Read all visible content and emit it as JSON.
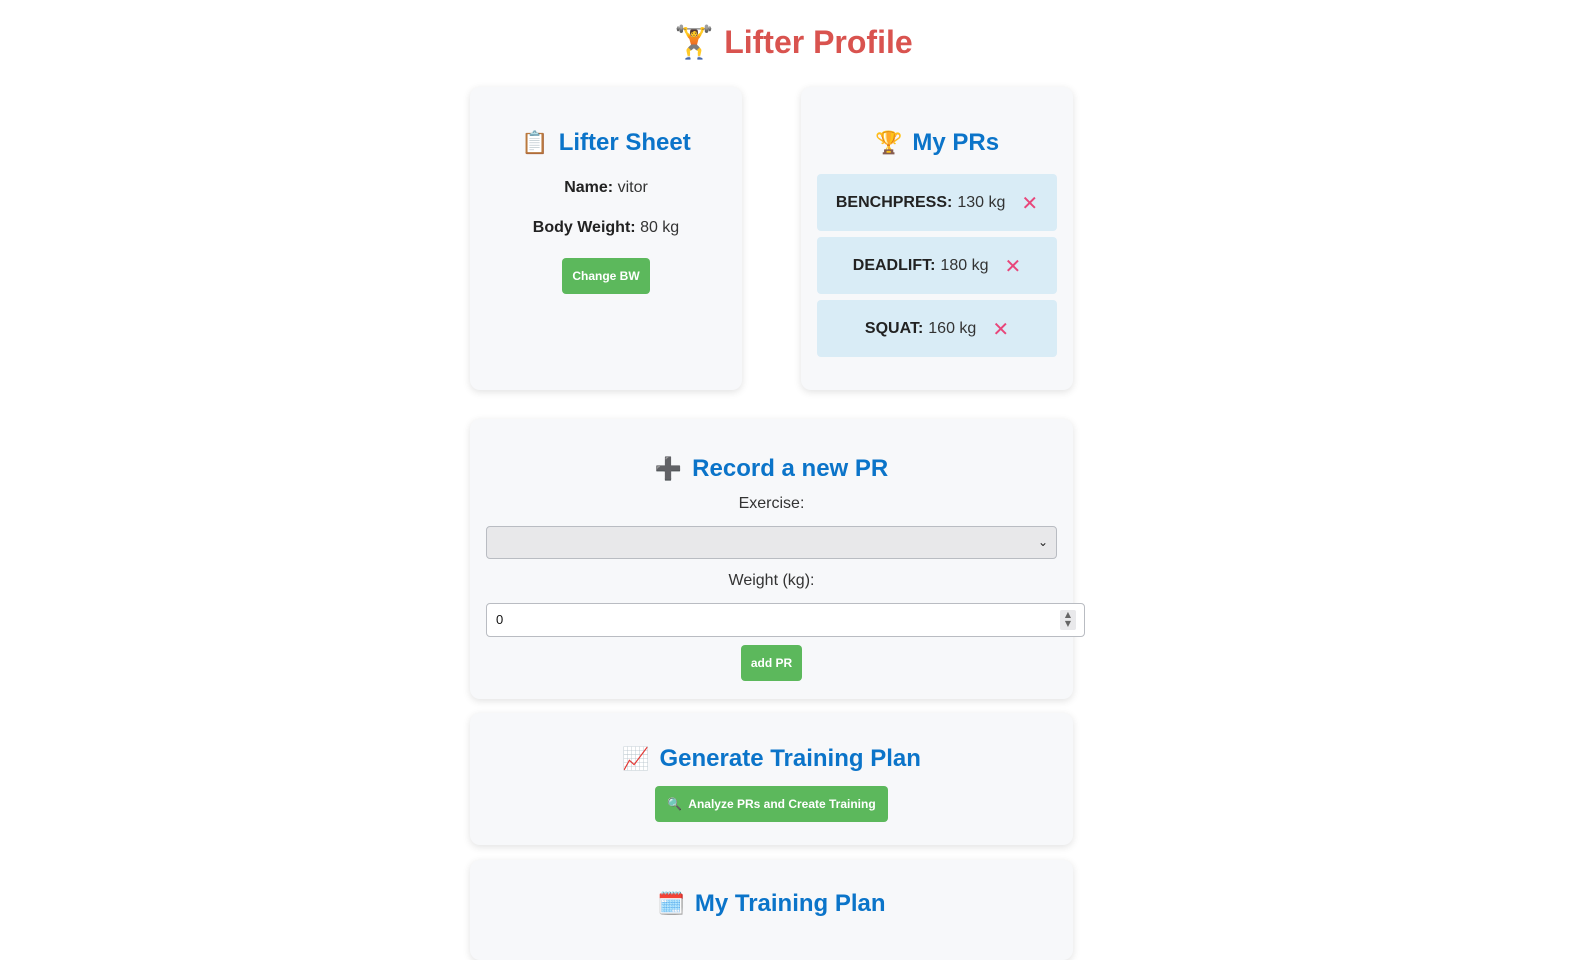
{
  "page": {
    "title": "Lifter Profile",
    "title_icon": "weightlifter-icon",
    "title_emoji": "🏋️"
  },
  "lifter_sheet": {
    "heading": "Lifter Sheet",
    "heading_icon": "clipboard-icon",
    "heading_emoji": "📋",
    "name_label": "Name:",
    "name_value": "vitor",
    "bw_label": "Body Weight:",
    "bw_value": "80 kg",
    "change_bw_label": "Change BW"
  },
  "my_prs": {
    "heading": "My PRs",
    "heading_icon": "trophy-icon",
    "heading_emoji": "🏆",
    "items": [
      {
        "exercise": "BENCHPRESS:",
        "weight": "130 kg"
      },
      {
        "exercise": "DEADLIFT:",
        "weight": "180 kg"
      },
      {
        "exercise": "SQUAT:",
        "weight": "160 kg"
      }
    ],
    "delete_glyph": "✕"
  },
  "record_pr": {
    "heading": "Record a new PR",
    "heading_icon": "plus-icon",
    "heading_emoji": "➕",
    "exercise_label": "Exercise:",
    "exercise_selected": "",
    "weight_label": "Weight (kg):",
    "weight_value": "0",
    "add_label": "add PR"
  },
  "generate_plan": {
    "heading": "Generate Training Plan",
    "heading_icon": "chart-increasing-icon",
    "heading_emoji": "📈",
    "button_label": "Analyze PRs and Create Training",
    "button_icon": "magnifier-icon",
    "button_emoji": "🔍"
  },
  "training_plan": {
    "heading": "My Training Plan",
    "heading_icon": "calendar-icon",
    "heading_emoji": "🗓️"
  },
  "colors": {
    "title": "#d9534f",
    "heading": "#0b74c9",
    "button": "#5cb85c",
    "pr_item_bg": "#d9ecf6",
    "delete": "#e8467a",
    "card_bg": "#f7f8fa"
  }
}
